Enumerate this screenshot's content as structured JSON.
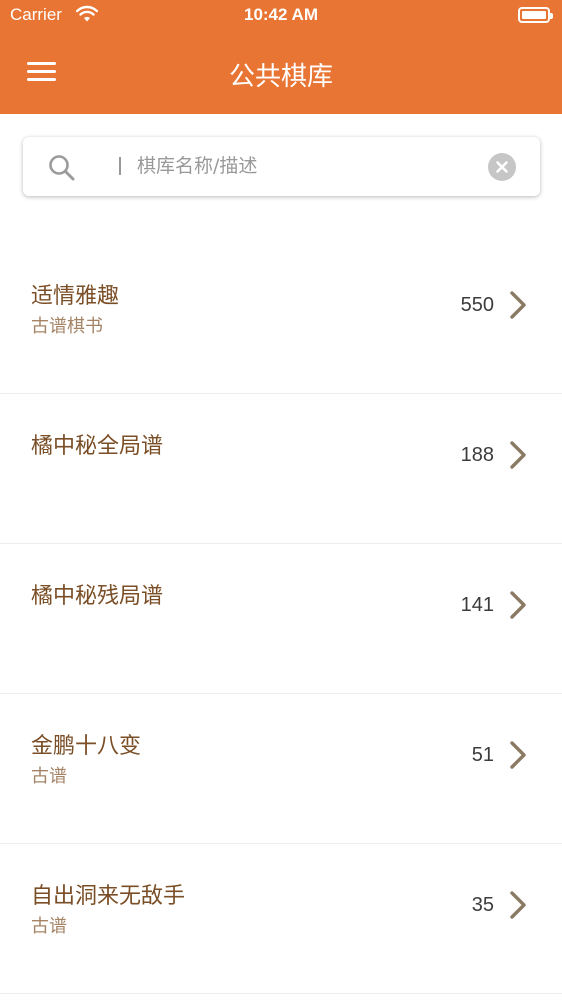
{
  "status_bar": {
    "carrier": "Carrier",
    "time": "10:42 AM"
  },
  "header": {
    "title": "公共棋库"
  },
  "search": {
    "placeholder": "棋库名称/描述",
    "value": ""
  },
  "items": [
    {
      "title": "适情雅趣",
      "subtitle": "古谱棋书",
      "count": "550"
    },
    {
      "title": "橘中秘全局谱",
      "subtitle": "",
      "count": "188"
    },
    {
      "title": "橘中秘残局谱",
      "subtitle": "",
      "count": "141"
    },
    {
      "title": "金鹏十八变",
      "subtitle": "古谱",
      "count": "51"
    },
    {
      "title": "自出洞来无敌手",
      "subtitle": "古谱",
      "count": "35"
    }
  ],
  "colors": {
    "header": "#E87534",
    "title_text": "#7a4e26",
    "subtitle_text": "#a58466",
    "chevron": "#8a7a64"
  },
  "icons": {
    "menu": "hamburger-icon",
    "search": "magnifier-icon",
    "clear": "clear-circle-icon",
    "row_action": "chevron-right-icon"
  }
}
